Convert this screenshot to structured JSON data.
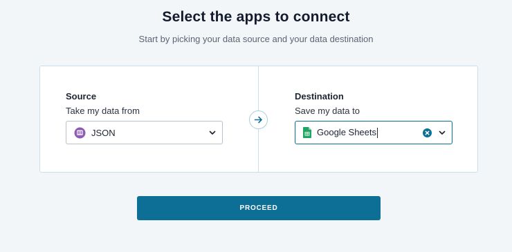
{
  "header": {
    "title": "Select the apps to connect",
    "subtitle": "Start by picking your data source and your data destination"
  },
  "source": {
    "heading": "Source",
    "subheading": "Take my data from",
    "selected": "JSON",
    "icon": "json-app-icon"
  },
  "destination": {
    "heading": "Destination",
    "subheading": "Save my data to",
    "selected": "Google Sheets",
    "icon": "google-sheets-icon"
  },
  "actions": {
    "proceed_label": "PROCEED"
  },
  "colors": {
    "accent": "#0e6f96",
    "focus_border": "#0b6f8e",
    "sheets_green": "#1fa463",
    "json_purple": "#8e5bb5"
  }
}
